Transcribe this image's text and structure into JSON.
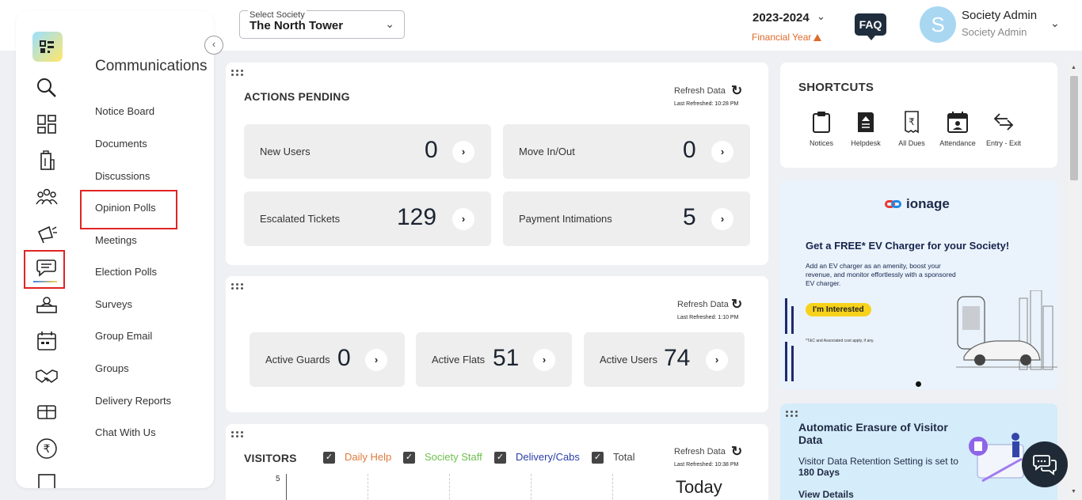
{
  "header": {
    "society_label": "Select Society",
    "society_value": "The North Tower",
    "year": "2023-2024",
    "financial_year": "Financial Year",
    "faq": "FAQ",
    "avatar_letter": "S",
    "user_name": "Society Admin",
    "user_role": "Society Admin"
  },
  "sidebar": {
    "section_title": "Communications",
    "items": [
      {
        "label": "Notice Board"
      },
      {
        "label": "Documents"
      },
      {
        "label": "Discussions"
      },
      {
        "label": "Opinion Polls"
      },
      {
        "label": "Meetings"
      },
      {
        "label": "Election Polls"
      },
      {
        "label": "Surveys"
      },
      {
        "label": "Group Email"
      },
      {
        "label": "Groups"
      },
      {
        "label": "Delivery Reports"
      },
      {
        "label": "Chat With Us"
      }
    ],
    "rail_icons": [
      "search-icon",
      "dashboard-icon",
      "building-icon",
      "residents-icon",
      "megaphone-icon",
      "chat-icon",
      "helpdesk-icon",
      "calendar-icon",
      "handshake-icon",
      "amenities-icon",
      "rupee-icon"
    ]
  },
  "actions_pending": {
    "title": "ACTIONS PENDING",
    "refresh": "Refresh Data",
    "last_refreshed": "Last Refreshed: 10:28 PM",
    "tiles": [
      {
        "label": "New Users",
        "value": "0"
      },
      {
        "label": "Move In/Out",
        "value": "0"
      },
      {
        "label": "Escalated Tickets",
        "value": "129"
      },
      {
        "label": "Payment Intimations",
        "value": "5"
      }
    ]
  },
  "stats": {
    "refresh": "Refresh Data",
    "last_refreshed": "Last Refreshed: 1:10 PM",
    "tiles": [
      {
        "label": "Active Guards",
        "value": "0"
      },
      {
        "label": "Active Flats",
        "value": "51"
      },
      {
        "label": "Active Users",
        "value": "74"
      }
    ]
  },
  "visitors": {
    "title": "VISITORS",
    "refresh": "Refresh Data",
    "last_refreshed": "Last Refreshed: 10:38 PM",
    "filters": [
      {
        "label": "Daily Help",
        "color": "#e07a3c"
      },
      {
        "label": "Society Staff",
        "color": "#6fbf4f"
      },
      {
        "label": "Delivery/Cabs",
        "color": "#2a3fa8"
      },
      {
        "label": "Total",
        "color": "#444444"
      }
    ],
    "y_tick": "5",
    "today": "Today"
  },
  "shortcuts": {
    "title": "SHORTCUTS",
    "items": [
      {
        "label": "Notices",
        "icon": "clipboard-icon"
      },
      {
        "label": "Helpdesk",
        "icon": "helpdesk-book-icon"
      },
      {
        "label": "All Dues",
        "icon": "rupee-receipt-icon"
      },
      {
        "label": "Attendance",
        "icon": "attendance-icon"
      },
      {
        "label": "Entry - Exit",
        "icon": "entry-exit-icon"
      }
    ]
  },
  "ad": {
    "brand": "ionage",
    "headline": "Get a FREE* EV Charger for your Society!",
    "body": "Add an EV charger as an amenity, boost your revenue, and monitor effortlessly with a sponsored EV charger.",
    "cta": "I'm Interested",
    "disclaimer": "*T&C and Associated cost apply, if any."
  },
  "erasure": {
    "title": "Automatic Erasure of Visitor Data",
    "text_prefix": "Visitor Data Retention Setting is set to ",
    "days": "180 Days",
    "link": "View Details"
  }
}
